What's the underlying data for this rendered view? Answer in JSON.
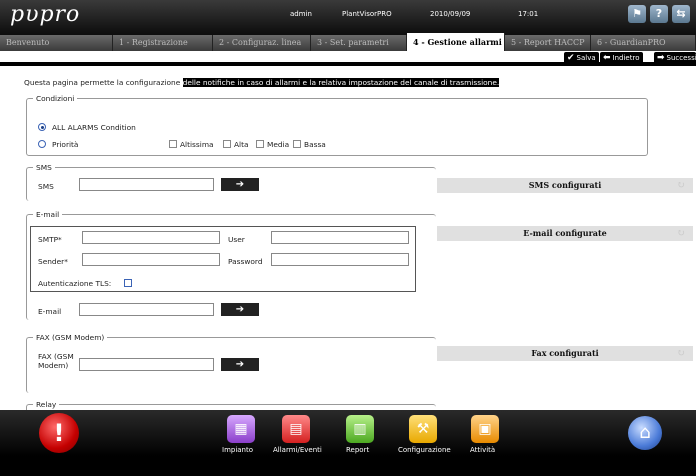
{
  "app": {
    "logo": "pυpro",
    "user": "admin",
    "product": "PlantVisorPRO",
    "date": "2010/09/09",
    "time": "17:01"
  },
  "header_icons": [
    {
      "name": "status-icon",
      "glyph": "⚑"
    },
    {
      "name": "help-icon",
      "glyph": "?"
    },
    {
      "name": "network-icon",
      "glyph": "⇆"
    }
  ],
  "tabs": [
    "Benvenuto",
    "1 - Registrazione",
    "2 - Configuraz. linea",
    "3 - Set. parametri",
    "4 - Gestione allarmi",
    "5 - Report HACCP",
    "6 - GuardianPRO"
  ],
  "active_tab": 4,
  "nav": {
    "save": "Salva",
    "back": "Indietro",
    "next": "Successivo"
  },
  "description": {
    "text": "Questa pagina permette la configurazione ",
    "highlight": "delle notifiche in caso di allarmi e la relativa impostazione del canale di trasmissione."
  },
  "conditions": {
    "legend": "Condizioni",
    "all_alarms": "ALL ALARMS Condition",
    "priority": "Priorità",
    "levels": [
      "Altissima",
      "Alta",
      "Media",
      "Bassa"
    ]
  },
  "sms": {
    "legend": "SMS",
    "label": "SMS",
    "configured": "SMS configurati"
  },
  "email": {
    "legend": "E-mail",
    "smtp": "SMTP*",
    "user": "User",
    "sender": "Sender*",
    "password": "Password",
    "tls": "Autenticazione TLS:",
    "email_label": "E-mail",
    "configured": "E-mail configurate"
  },
  "fax": {
    "legend": "FAX (GSM Modem)",
    "label": "FAX (GSM Modem)",
    "configured": "Fax configurati"
  },
  "relay": {
    "legend": "Relay"
  },
  "footer": {
    "items": [
      "Impianto",
      "Allarmi/Eventi",
      "Report",
      "Configurazione",
      "Attività"
    ]
  },
  "colors": {
    "accent": "#1b3f86",
    "header": "#111111",
    "bar": "#e0e0e0"
  }
}
